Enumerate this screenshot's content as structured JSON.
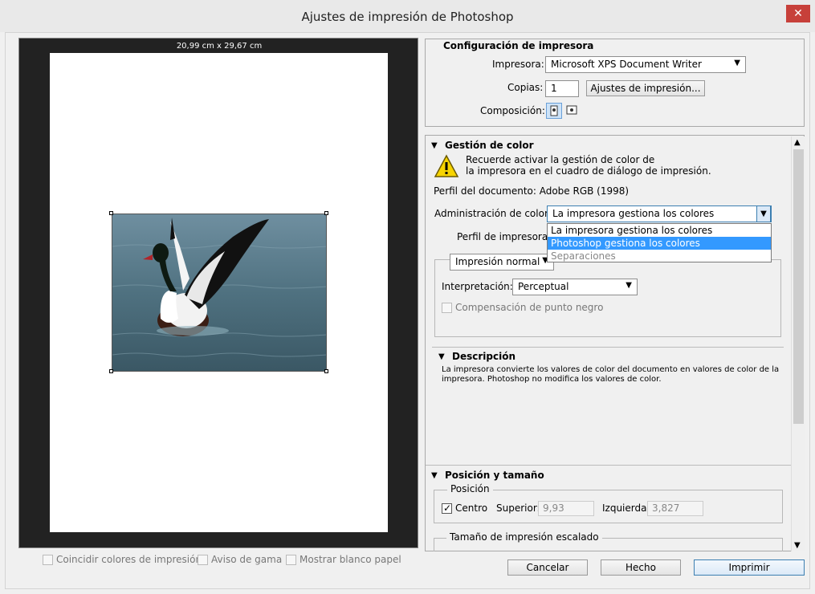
{
  "window": {
    "title": "Ajustes de impresión de Photoshop",
    "close_label": "✕"
  },
  "preview": {
    "size_label": "20,99 cm x 29,67 cm"
  },
  "bottom_checks": [
    {
      "label": "Coincidir colores de impresión"
    },
    {
      "label": "Aviso de gama"
    },
    {
      "label": "Mostrar blanco papel"
    }
  ],
  "printer_setup": {
    "title": "Configuración de impresora",
    "printer_label": "Impresora:",
    "printer_value": "Microsoft XPS Document Writer",
    "copies_label": "Copias:",
    "copies_value": "1",
    "print_settings_button": "Ajustes de impresión...",
    "composition_label": "Composición:"
  },
  "color_management": {
    "title": "Gestión de color",
    "warning_line1": "Recuerde activar la gestión de color de",
    "warning_line2": "la impresora en el cuadro de diálogo de impresión.",
    "doc_profile": "Perfil del documento: Adobe RGB (1998)",
    "admin_label": "Administración de color:",
    "admin_value": "La impresora gestiona los colores",
    "admin_options": [
      "La impresora gestiona los colores",
      "Photoshop gestiona los colores",
      "Separaciones"
    ],
    "printer_profile_label": "Perfil de impresora:",
    "normal_print_value": "Impresión normal",
    "render_label": "Interpretación:",
    "render_value": "Perceptual",
    "black_point_label": "Compensación de punto negro"
  },
  "description": {
    "title": "Descripción",
    "text_line1": "La impresora convierte los valores de color del documento en valores de color de la",
    "text_line2": "impresora. Photoshop no modifica los valores de color."
  },
  "position": {
    "title": "Posición y tamaño",
    "group_label": "Posición",
    "center_label": "Centro",
    "top_label": "Superior:",
    "top_value": "9,93",
    "left_label": "Izquierda:",
    "left_value": "3,827",
    "scaled_label": "Tamaño de impresión escalado"
  },
  "buttons": {
    "cancel": "Cancelar",
    "done": "Hecho",
    "print": "Imprimir"
  }
}
